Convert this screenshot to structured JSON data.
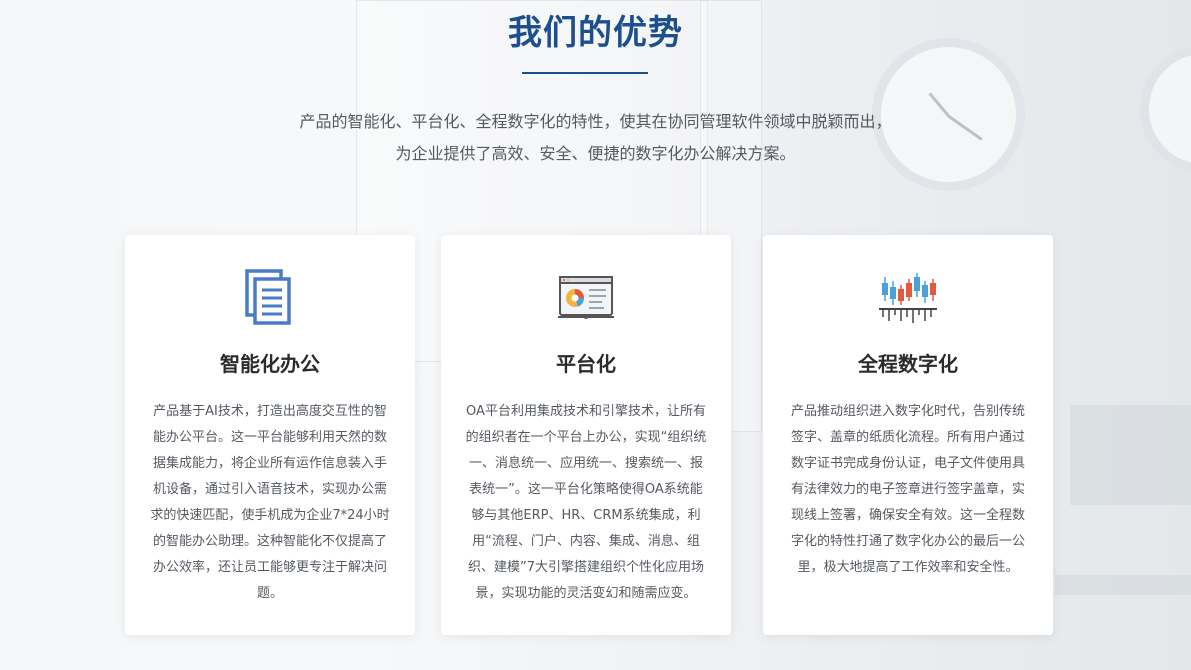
{
  "section": {
    "title": "我们的优势",
    "intro_line1": "产品的智能化、平台化、全程数字化的特性，使其在协同管理软件领域中脱颖而出，",
    "intro_line2": "为企业提供了高效、安全、便捷的数字化办公解决方案。"
  },
  "cards": [
    {
      "icon": "document-stack-icon",
      "title": "智能化办公",
      "desc": "产品基于AI技术，打造出高度交互性的智能办公平台。这一平台能够利用天然的数据集成能力，将企业所有运作信息装入手机设备，通过引入语音技术，实现办公需求的快速匹配，使手机成为企业7*24小时的智能办公助理。这种智能化不仅提高了办公效率，还让员工能够更专注于解决问题。"
    },
    {
      "icon": "dashboard-chart-icon",
      "title": "平台化",
      "desc": "OA平台利用集成技术和引擎技术，让所有的组织者在一个平台上办公，实现“组织统一、消息统一、应用统一、搜索统一、报表统一”。这一平台化策略使得OA系统能够与其他ERP、HR、CRM系统集成，利用“流程、门户、内容、集成、消息、组织、建模”7大引擎搭建组织个性化应用场景，实现功能的灵活变幻和随需应变。"
    },
    {
      "icon": "candlestick-chart-icon",
      "title": "全程数字化",
      "desc": "产品推动组织进入数字化时代，告别传统签字、盖章的纸质化流程。所有用户通过数字证书完成身份认证，电子文件使用具有法律效力的电子签章进行签字盖章，实现线上签署，确保安全有效。这一全程数字化的特性打通了数字化办公的最后一公里，极大地提高了工作效率和安全性。"
    }
  ],
  "colors": {
    "title": "#1c4f8c",
    "text": "#555a60",
    "heading": "#2b2b2b"
  }
}
